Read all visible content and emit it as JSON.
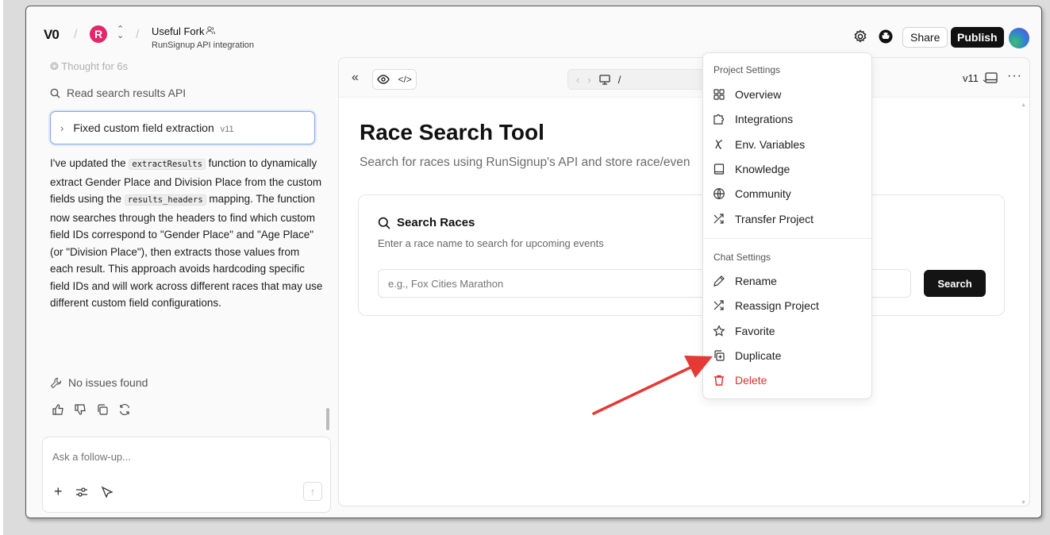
{
  "header": {
    "logo": "V0",
    "project_initial": "R",
    "project_title": "Useful Fork",
    "project_subtitle": "RunSignup API integration",
    "share_label": "Share",
    "publish_label": "Publish"
  },
  "chat": {
    "thought": "Thought for 6s",
    "step": "Read search results API",
    "fixed_label": "Fixed custom field extraction",
    "fixed_version": "v11",
    "message": {
      "p1": "I've updated the ",
      "code1": "extractResults",
      "p2": " function to dynamically extract Gender Place and Division Place from the custom fields using the ",
      "code2": "results_headers",
      "p3": " mapping. The function now searches through the headers to find which custom field IDs correspond to \"Gender Place\" and \"Age Place\" (or \"Division Place\"), then extracts those values from each result. This approach avoids hardcoding specific field IDs and will work across different races that may use different custom field configurations."
    },
    "no_issues": "No issues found",
    "composer_placeholder": "Ask a follow-up..."
  },
  "preview": {
    "url_path": "/",
    "version": "v11",
    "page_title": "Race Search Tool",
    "page_subtitle": "Search for races using RunSignup's API and store race/even",
    "card_title": "Search Races",
    "card_subtitle": "Enter a race name to search for upcoming events",
    "input_placeholder": "e.g., Fox Cities Marathon",
    "search_button": "Search"
  },
  "menu": {
    "project_section": "Project Settings",
    "project_items": [
      "Overview",
      "Integrations",
      "Env. Variables",
      "Knowledge",
      "Community",
      "Transfer Project"
    ],
    "chat_section": "Chat Settings",
    "chat_items": [
      "Rename",
      "Reassign Project",
      "Favorite",
      "Duplicate"
    ],
    "delete_label": "Delete"
  },
  "colors": {
    "accent_danger": "#d93030",
    "annotation_arrow": "#e53935",
    "project_avatar": "#e5266b"
  }
}
